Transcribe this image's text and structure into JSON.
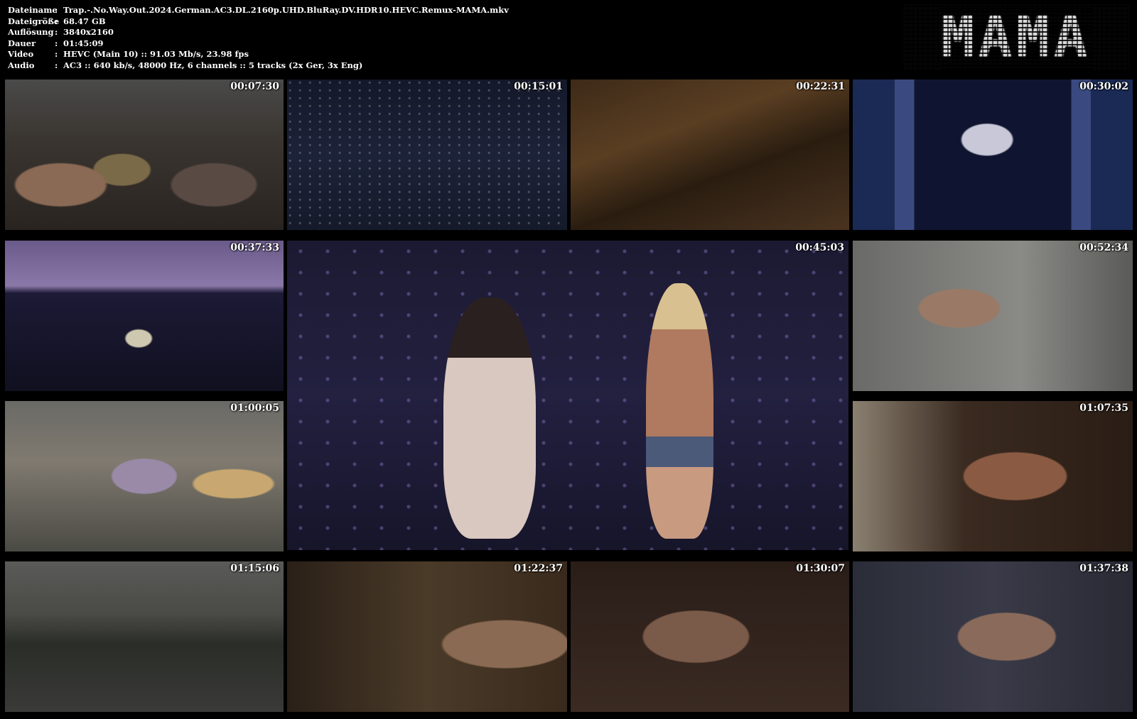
{
  "info": [
    {
      "key": "Dateiname",
      "value": "Trap.-.No.Way.Out.2024.German.AC3.DL.2160p.UHD.BluRay.DV.HDR10.HEVC.Remux-MAMA.mkv"
    },
    {
      "key": "Dateigröße",
      "value": "68.47 GB"
    },
    {
      "key": "Auflösung",
      "value": "3840x2160"
    },
    {
      "key": "Dauer",
      "value": "01:45:09"
    },
    {
      "key": "Video",
      "value": "HEVC (Main 10) :: 91.03 Mb/s, 23.98 fps"
    },
    {
      "key": "Audio",
      "value": "AC3 :: 640 kb/s, 48000 Hz, 6 channels :: 5 tracks (2x Ger, 3x Eng)"
    }
  ],
  "separator": ":",
  "logo_text": "MAMA",
  "timestamps": [
    "00:07:30",
    "00:15:01",
    "00:22:31",
    "00:30:02",
    "00:37:33",
    "00:45:03",
    "00:52:34",
    "01:00:05",
    "01:07:35",
    "01:15:06",
    "01:22:37",
    "01:30:07",
    "01:37:38"
  ],
  "colors": {
    "background": "#000000",
    "text": "#ffffff"
  }
}
